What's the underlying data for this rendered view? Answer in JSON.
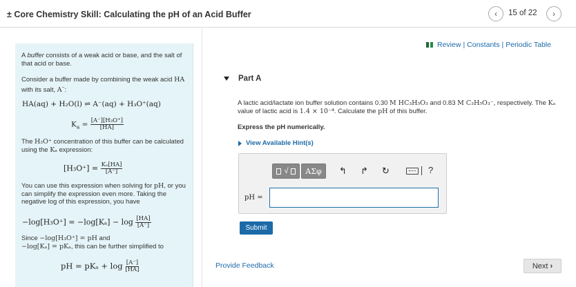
{
  "header": {
    "title": "± Core Chemistry Skill: Calculating the pH of an Acid Buffer",
    "page_indicator": "15 of 22",
    "prev_icon": "chevron-left-icon",
    "next_icon": "chevron-right-icon"
  },
  "resources": {
    "icon": "books-icon",
    "review": "Review",
    "constants": "Constants",
    "periodic_table": "Periodic Table",
    "separator": "|"
  },
  "sidebar": {
    "intro_prefix": "A ",
    "intro_em": "buffer",
    "intro_suffix": " consists of a weak acid or base, and the salt of that acid or base.",
    "consider_text": "Consider a buffer made by combining the weak acid ",
    "consider_ha": "HA",
    "consider_mid": " with its salt, ",
    "consider_a": "A",
    "consider_end": ":",
    "equilibrium": "HA(aq) + H₂O(l) ⇌ A⁻(aq) + H₃O⁺(aq)",
    "ka_lhs": "K",
    "ka_num": "[A⁻][H₃O⁺]",
    "ka_den": "[HA]",
    "conc_text_a": "The ",
    "conc_text_ion": "H₃O⁺",
    "conc_text_b": " concentration of this buffer can be calculated using the ",
    "conc_text_k": "Kₐ",
    "conc_text_c": " expression:",
    "h3o_lhs": "[H₃O⁺] = ",
    "h3o_num": "Kₐ[HA]",
    "h3o_den": "[A⁻]",
    "use_text_a": "You can use this expression when solving for ",
    "use_text_ph": "pH",
    "use_text_b": ", or you can simplify the expression even more. Taking the negative log of this expression, you have",
    "log_lhs": "−log[H₃O⁺] = −log[Kₐ] − log",
    "log_num": "[HA]",
    "log_den": "[A⁻]",
    "since_a": "Since ",
    "since_m1": "−log[H₃O⁺] = pH",
    "since_b": " and",
    "since_m2": "−log[Kₐ] = pKₐ",
    "since_c": ", this can be further simplified to",
    "hh_lhs": "pH = pKₐ + log",
    "hh_num": "[A⁻]",
    "hh_den": "[HA]"
  },
  "part": {
    "title": "Part A",
    "question_a": "A lactic acid/lactate ion buffer solution contains 0.30 ",
    "question_m1": "M HC₃H₅O₃",
    "question_b": " and 0.83 ",
    "question_m2": "M C₃H₅O₃⁻",
    "question_c": ", respectively. The ",
    "question_k": "Kₐ",
    "question_d": " value of lactic acid is ",
    "question_val": "1.4 × 10⁻⁴",
    "question_e": ". Calculate the ",
    "question_ph": "pH",
    "question_f": " of this buffer.",
    "instruction": "Express the pH numerically.",
    "hint": "View Available Hint(s)"
  },
  "answer": {
    "greek_label": "ΑΣφ",
    "template_label": "√▢",
    "undo_icon": "undo-icon",
    "redo_icon": "redo-icon",
    "reset_icon": "reset-icon",
    "keyboard_icon": "keyboard-icon",
    "help_label": "?",
    "ph_label": "pH =",
    "value": ""
  },
  "buttons": {
    "submit": "Submit",
    "feedback": "Provide Feedback",
    "next": "Next"
  }
}
